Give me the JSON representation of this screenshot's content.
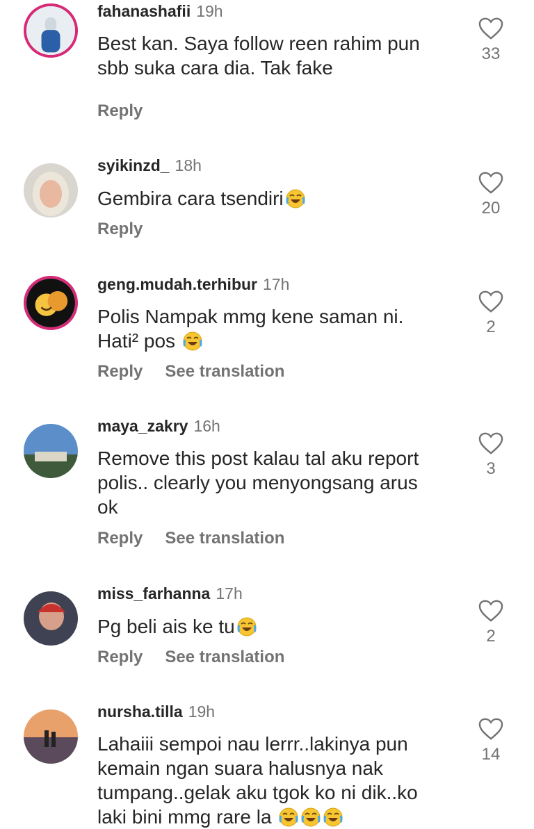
{
  "comments": [
    {
      "username": "fahanashafii",
      "time": "19h",
      "text": "Best kan. Saya follow reen rahim pun\nsbb suka cara dia. Tak fake",
      "emoji_count": 0,
      "likes": "33",
      "reply": "Reply",
      "translation": ""
    },
    {
      "username": "syikinzd_",
      "time": "18h",
      "text": "Gembira cara tsendiri",
      "emoji_count": 1,
      "likes": "20",
      "reply": "Reply",
      "translation": ""
    },
    {
      "username": "geng.mudah.terhibur",
      "time": "17h",
      "text": "Polis Nampak mmg kene saman ni.\nHati² pos ",
      "emoji_count": 1,
      "likes": "2",
      "reply": "Reply",
      "translation": "See translation"
    },
    {
      "username": "maya_zakry",
      "time": "16h",
      "text": "Remove this post kalau tal aku report\npolis.. clearly you menyongsang arus\nok",
      "emoji_count": 0,
      "likes": "3",
      "reply": "Reply",
      "translation": "See translation"
    },
    {
      "username": "miss_farhanna",
      "time": "17h",
      "text": "Pg beli ais ke tu",
      "emoji_count": 1,
      "likes": "2",
      "reply": "Reply",
      "translation": "See translation"
    },
    {
      "username": "nursha.tilla",
      "time": "19h",
      "text": "Lahaiii sempoi nau lerrr..lakinya pun\nkemain ngan suara halusnya nak\ntumpang..gelak aku tgok ko ni dik..ko\nlaki bini mmg rare la ",
      "emoji_count": 3,
      "likes": "14",
      "reply": "",
      "translation": ""
    }
  ],
  "icons": {
    "like": "heart-outline-icon",
    "emoji": "face-with-tears-of-joy-emoji"
  },
  "colors": {
    "story_ring": "#d62976",
    "secondary_text": "#737373",
    "primary_text": "#262626"
  }
}
